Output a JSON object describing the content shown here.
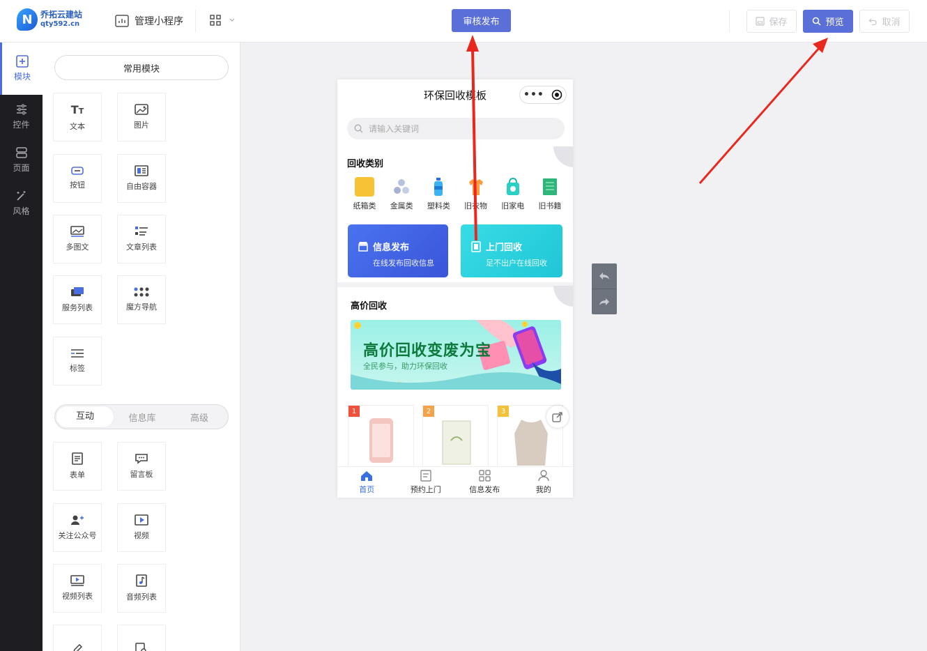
{
  "header": {
    "logo_name": "乔拓云建站",
    "logo_domain": "qty592.cn",
    "manage_label": "管理小程序",
    "audit_publish": "审核发布",
    "save": "保存",
    "preview": "预览",
    "cancel": "取消"
  },
  "rail": [
    {
      "label": "模块",
      "icon": "plus-square-icon"
    },
    {
      "label": "控件",
      "icon": "sliders-icon"
    },
    {
      "label": "页面",
      "icon": "pages-icon"
    },
    {
      "label": "风格",
      "icon": "magic-wand-icon"
    }
  ],
  "panel": {
    "common_label": "常用模块",
    "common_modules": [
      "文本",
      "图片",
      "按钮",
      "自由容器",
      "多图文",
      "文章列表",
      "服务列表",
      "魔方导航",
      "标签"
    ],
    "tabs": [
      "互动",
      "信息库",
      "高级"
    ],
    "interactive_modules": [
      "表单",
      "留言板",
      "关注公众号",
      "视频",
      "视频列表",
      "音频列表"
    ]
  },
  "phone": {
    "title": "环保回收模板",
    "search_placeholder": "请输入关键词",
    "section_category": "回收类别",
    "categories": [
      "纸箱类",
      "金属类",
      "塑料类",
      "旧衣物",
      "旧家电",
      "旧书籍"
    ],
    "card1": {
      "title": "信息发布",
      "sub": "在线发布回收信息"
    },
    "card2": {
      "title": "上门回收",
      "sub": "足不出户在线回收"
    },
    "section_high": "高价回收",
    "banner_big": "高价回收变废为宝",
    "banner_small": "全民参与，助力环保回收",
    "ranks": [
      "1",
      "2",
      "3"
    ],
    "tabs": [
      "首页",
      "预约上门",
      "信息发布",
      "我的"
    ]
  },
  "colors": {
    "accent": "#5a6fd8",
    "rail_bg": "#1e1e22",
    "active_blue": "#4a6ee0",
    "arrow_red": "#e8281e"
  }
}
